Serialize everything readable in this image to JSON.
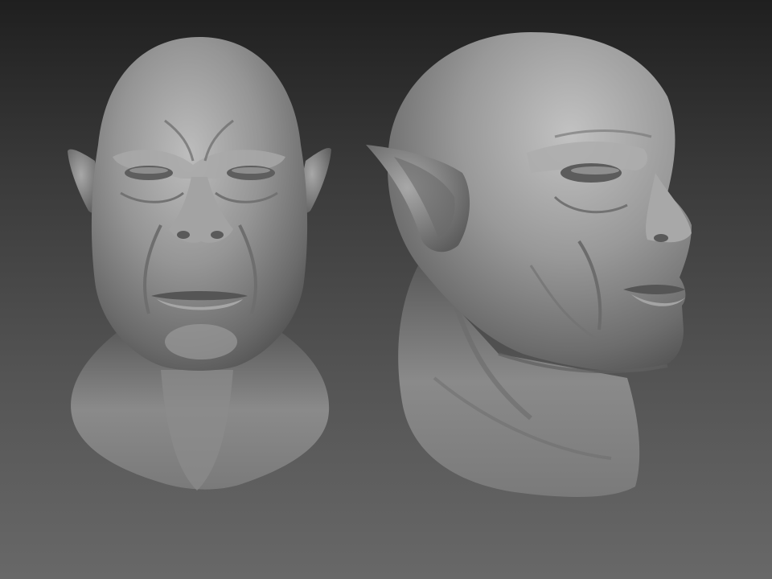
{
  "scene": {
    "background_top": "#1f1f1f",
    "background_bottom": "#686868",
    "clay_color": "#8f8f8f",
    "views": [
      {
        "name": "front-view",
        "orientation": "front"
      },
      {
        "name": "three-quarter-view",
        "orientation": "three-quarter-right"
      }
    ]
  }
}
